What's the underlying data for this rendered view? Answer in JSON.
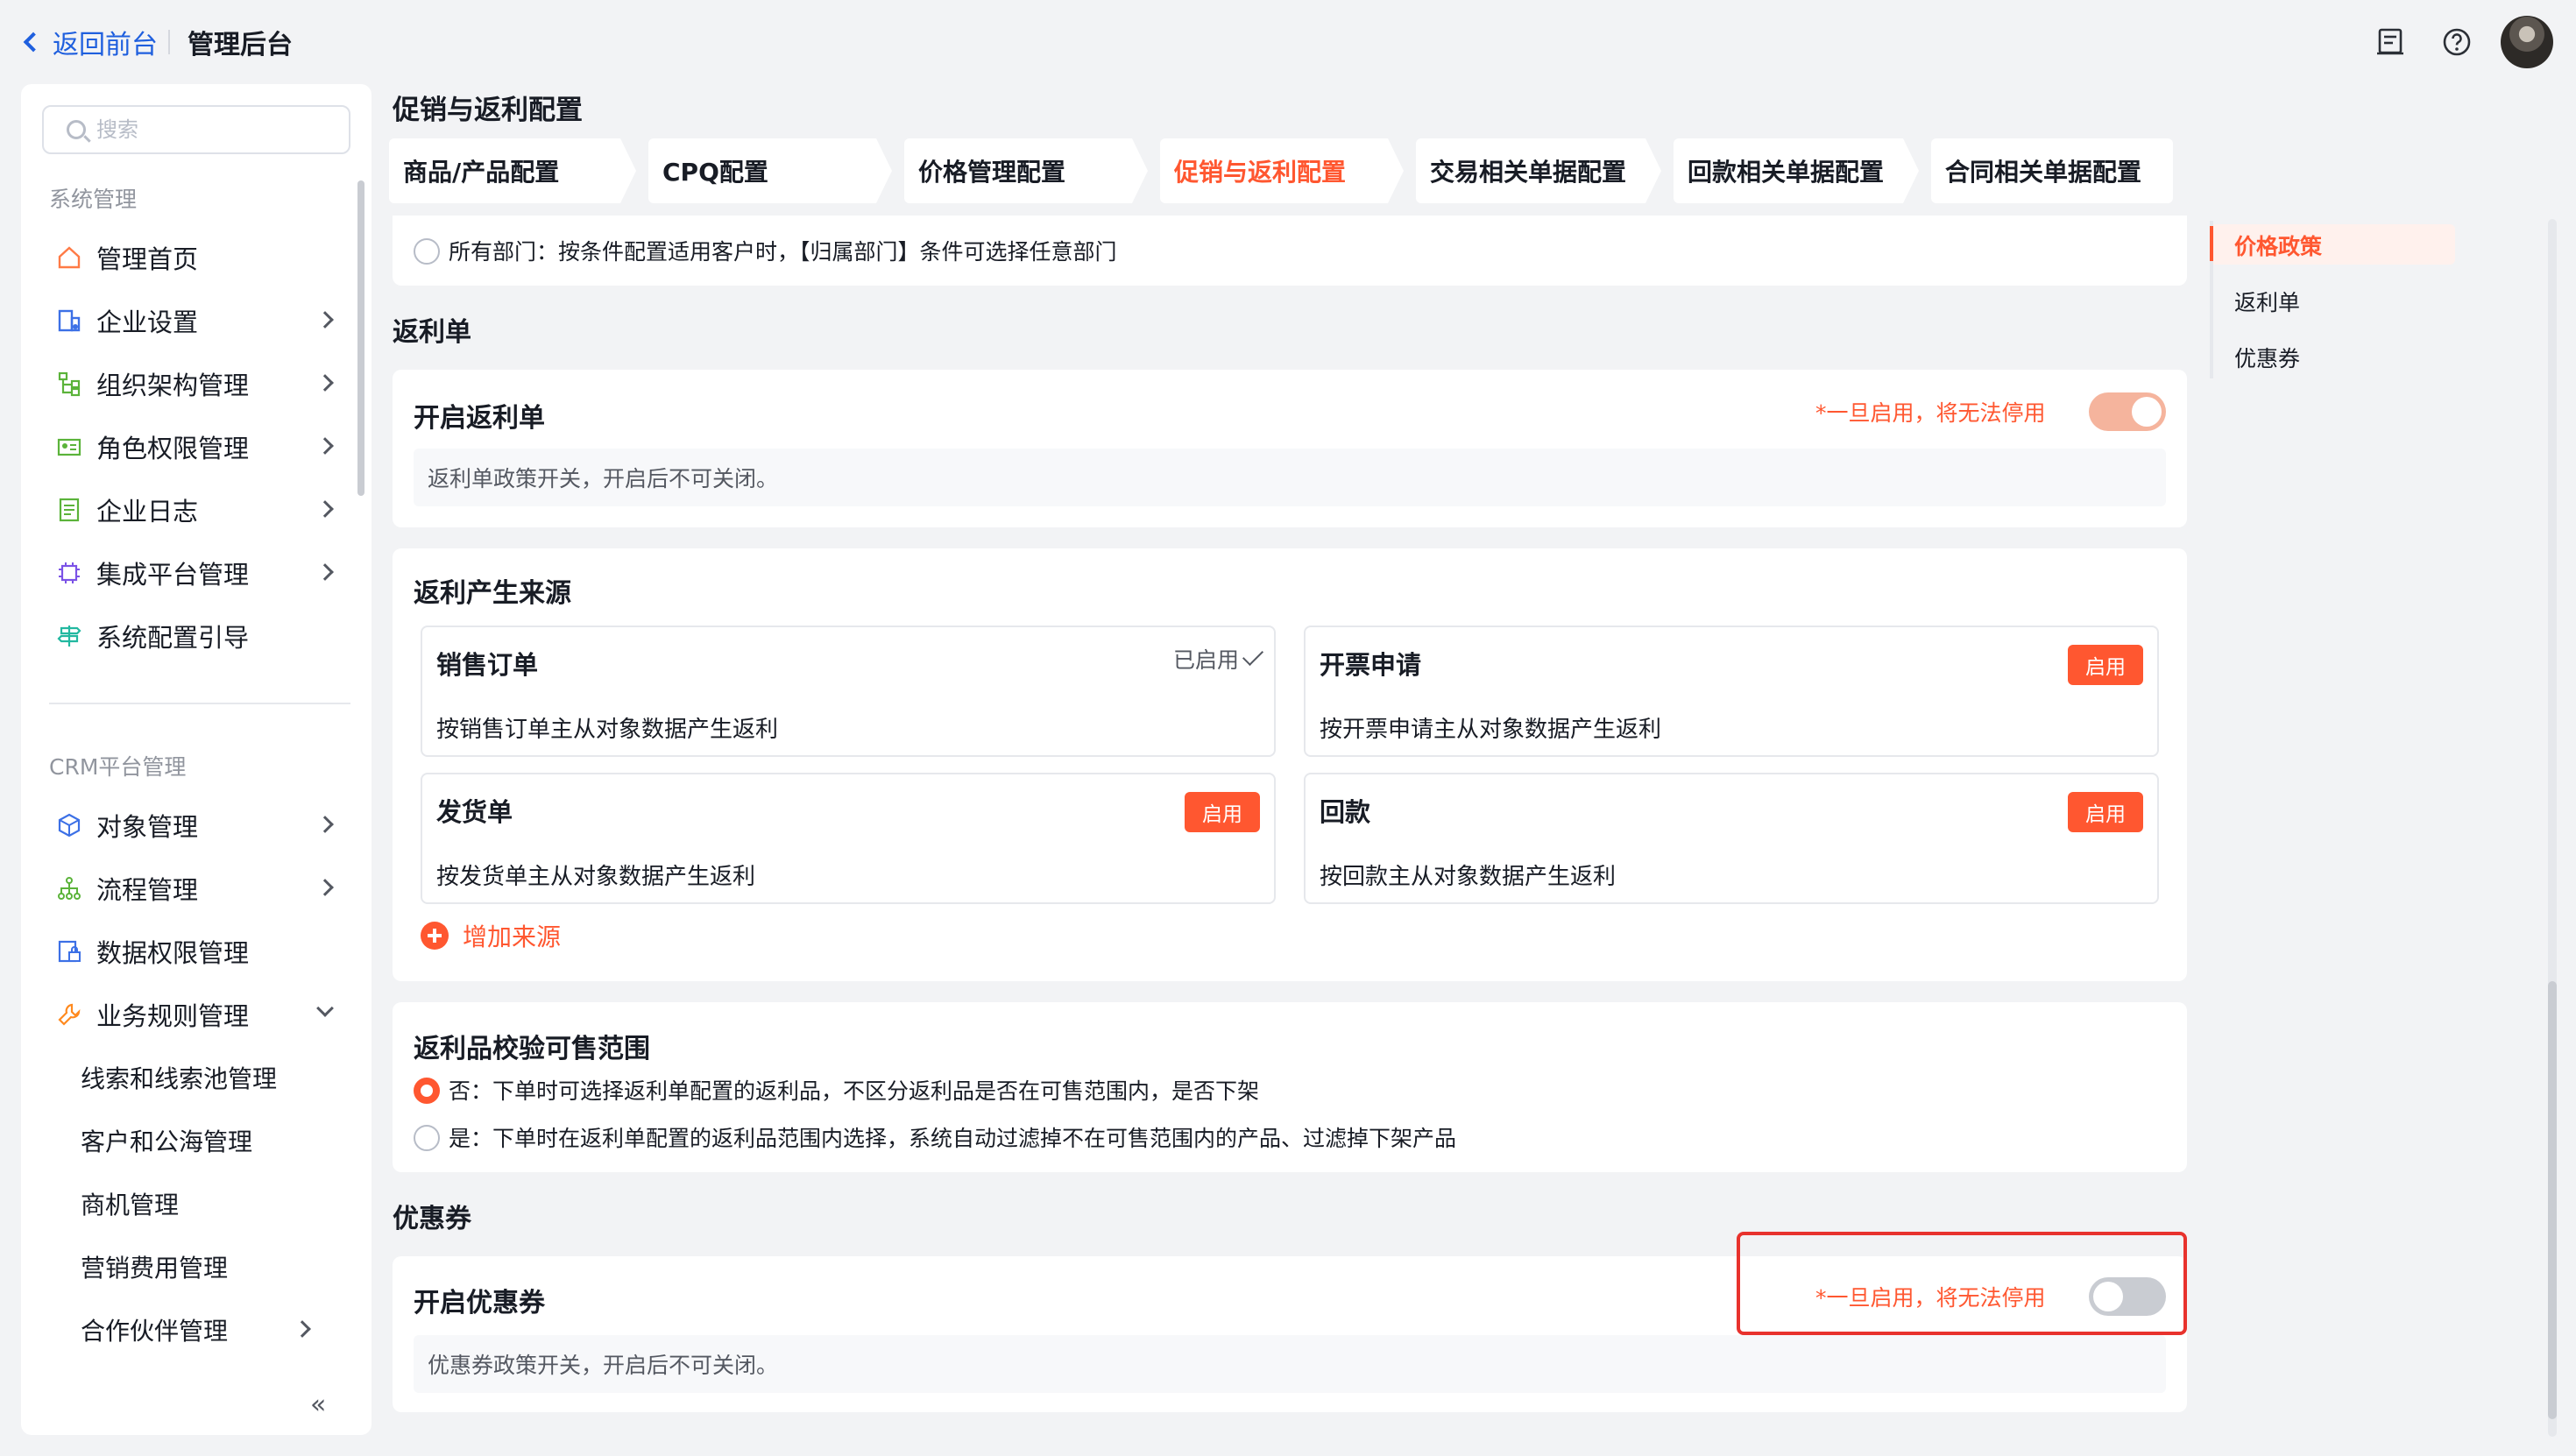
{
  "topbar": {
    "back_label": "返回前台",
    "title": "管理后台",
    "icons": [
      "notes-icon",
      "help-icon"
    ]
  },
  "sidebar": {
    "search_placeholder": "搜索",
    "group1": "系统管理",
    "items1": [
      {
        "label": "管理首页",
        "icon": "home-icon"
      },
      {
        "label": "企业设置",
        "icon": "enterprise-icon"
      },
      {
        "label": "组织架构管理",
        "icon": "org-chart-icon"
      },
      {
        "label": "角色权限管理",
        "icon": "id-card-icon"
      },
      {
        "label": "企业日志",
        "icon": "log-icon"
      },
      {
        "label": "集成平台管理",
        "icon": "chip-icon"
      },
      {
        "label": "系统配置引导",
        "icon": "signpost-icon"
      }
    ],
    "group2": "CRM平台管理",
    "items2": [
      {
        "label": "对象管理",
        "icon": "cube-icon"
      },
      {
        "label": "流程管理",
        "icon": "flow-icon"
      },
      {
        "label": "数据权限管理",
        "icon": "data-lock-icon"
      },
      {
        "label": "业务规则管理",
        "icon": "wrench-icon"
      }
    ],
    "subitems": [
      {
        "label": "线索和线索池管理"
      },
      {
        "label": "客户和公海管理"
      },
      {
        "label": "商机管理"
      },
      {
        "label": "营销费用管理"
      },
      {
        "label": "合作伙伴管理"
      }
    ],
    "collapse_label": "«"
  },
  "main": {
    "title": "促销与返利配置",
    "tabs": [
      {
        "label": "商品/产品配置"
      },
      {
        "label": "CPQ配置"
      },
      {
        "label": "价格管理配置"
      },
      {
        "label": "促销与返利配置"
      },
      {
        "label": "交易相关单据配置"
      },
      {
        "label": "回款相关单据配置"
      },
      {
        "label": "合同相关单据配置"
      }
    ],
    "top_partial": {
      "radio_label": "所有部门：按条件配置适用客户时，【归属部门】条件可选择任意部门"
    },
    "rebate": {
      "section_title": "返利单",
      "card_title": "开启返利单",
      "warning": "*一旦启用，将无法停用",
      "desc": "返利单政策开关，开启后不可关闭。"
    },
    "sources": {
      "title": "返利产生来源",
      "items": [
        {
          "title": "销售订单",
          "desc": "按销售订单主从对象数据产生返利",
          "status": "已启用"
        },
        {
          "title": "开票申请",
          "desc": "按开票申请主从对象数据产生返利",
          "button": "启用"
        },
        {
          "title": "发货单",
          "desc": "按发货单主从对象数据产生返利",
          "button": "启用"
        },
        {
          "title": "回款",
          "desc": "按回款主从对象数据产生返利",
          "button": "启用"
        }
      ],
      "add_label": "增加来源"
    },
    "scope": {
      "title": "返利品校验可售范围",
      "options": [
        {
          "label": "否：下单时可选择返利单配置的返利品，不区分返利品是否在可售范围内，是否下架"
        },
        {
          "label": "是：下单时在返利单配置的返利品范围内选择，系统自动过滤掉不在可售范围内的产品、过滤掉下架产品"
        }
      ]
    },
    "coupon": {
      "section_title": "优惠券",
      "card_title": "开启优惠券",
      "warning": "*一旦启用，将无法停用",
      "desc": "优惠券政策开关，开启后不可关闭。"
    }
  },
  "anchor_nav": {
    "items": [
      {
        "label": "价格政策"
      },
      {
        "label": "返利单"
      },
      {
        "label": "优惠券"
      }
    ]
  },
  "colors": {
    "accent": "#ff5730",
    "link": "#1f5fde",
    "highlight": "#e8322d"
  }
}
